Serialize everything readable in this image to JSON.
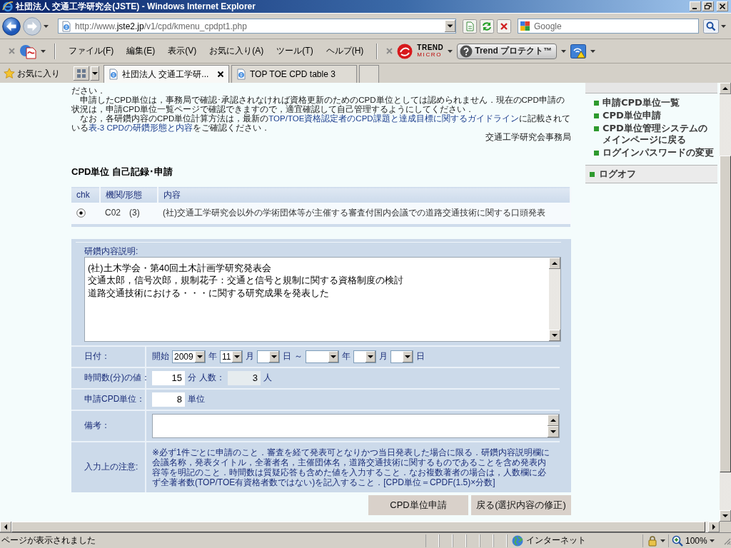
{
  "window": {
    "title": "社団法人 交通工学研究会(JSTE) - Windows Internet Explorer"
  },
  "address_bar": {
    "url": "http://www.jste2.jp/v1/cpd/kmenu_cpdpt1.php"
  },
  "search": {
    "placeholder": "Google"
  },
  "menu_bar": {
    "items": [
      "ファイル(F)",
      "編集(E)",
      "表示(V)",
      "お気に入り(A)",
      "ツール(T)",
      "ヘルプ(H)"
    ]
  },
  "toolbar": {
    "logo_top": "TREND",
    "logo_bottom": "MICRO",
    "protect_button": "Trend プロテクト™"
  },
  "favorites_bar": {
    "label": "お気に入り"
  },
  "tabs": [
    {
      "label": "社団法人 交通工学研...",
      "selected": true
    },
    {
      "label": "TOP TOE CPD table 3",
      "selected": false
    }
  ],
  "intro": {
    "paragraphs": [
      [
        {
          "kind": "text",
          "text": "ださい．"
        }
      ],
      [
        {
          "kind": "text",
          "text": "　申請したCPD単位は，事務局で確認･承認されなければ資格更新のためのCPD単位としては認められません．現在のCPD申請の状況は，申請CPD単位一覧ページで確認できますので，適宜確認して自己管理するようにしてください．"
        }
      ],
      [
        {
          "kind": "text",
          "text": "　なお，各研鑽内容のCPD単位計算方法は，最新の"
        },
        {
          "kind": "link",
          "text": "TOP/TOE資格認定者のCPD課題と達成目標に関するガイドライン"
        },
        {
          "kind": "text",
          "text": "に記載されている"
        },
        {
          "kind": "link",
          "text": "表-3 CPDの研鑽形態と内容"
        },
        {
          "kind": "text",
          "text": "をご確認ください．"
        }
      ]
    ],
    "signature": "交通工学研究会事務局"
  },
  "section_title": "CPD単位 自己記録･申請",
  "table": {
    "columns": [
      "chk",
      "機関/形態",
      "内容"
    ],
    "rows": [
      {
        "selected": true,
        "organization_form": "C02　(3)",
        "content": "(社)交通工学研究会以外の学術団体等が主催する審査付国内会議での道路交通技術に関する口頭発表"
      }
    ]
  },
  "form": {
    "description": {
      "label": "研鑽内容説明:",
      "lines": [
        "(社)土木学会・第40回土木計画学研究発表会",
        "交通太郎，信号次郎，規制花子：交通と信号と規制に関する資格制度の検討",
        "道路交通技術における・・・に関する研究成果を発表した"
      ]
    },
    "rows": [
      {
        "label": "日付：",
        "parts": [
          {
            "kind": "text",
            "text": "開始"
          },
          {
            "kind": "select",
            "value": "2009",
            "wide": true
          },
          {
            "kind": "text",
            "text": "年"
          },
          {
            "kind": "select",
            "value": "11",
            "wide": false
          },
          {
            "kind": "text",
            "text": "月"
          },
          {
            "kind": "select",
            "wide": false
          },
          {
            "kind": "text",
            "text": "日"
          },
          {
            "kind": "text",
            "text": "～"
          },
          {
            "kind": "select",
            "wide": true
          },
          {
            "kind": "text",
            "text": "年"
          },
          {
            "kind": "select",
            "wide": false
          },
          {
            "kind": "text",
            "text": "月"
          },
          {
            "kind": "select",
            "wide": false
          },
          {
            "kind": "text",
            "text": "日"
          }
        ]
      },
      {
        "label": "時間数(分)の値：",
        "parts": [
          {
            "kind": "input",
            "value": "15",
            "disabled": false
          },
          {
            "kind": "text",
            "text": "分"
          },
          {
            "kind": "text",
            "text": "人数："
          },
          {
            "kind": "input",
            "value": "3",
            "disabled": true
          },
          {
            "kind": "text",
            "text": "人"
          }
        ]
      },
      {
        "label": "申請CPD単位：",
        "parts": [
          {
            "kind": "input",
            "value": "8",
            "disabled": false
          },
          {
            "kind": "text",
            "text": "単位"
          }
        ]
      },
      {
        "label": "備考：",
        "parts": [
          {
            "kind": "textarea"
          }
        ]
      },
      {
        "label": "入力上の注意:",
        "parts": [
          {
            "kind": "note",
            "text": "※必ず1件ごとに申請のこと．審査を経て発表可となりかつ当日発表した場合に限る．研鑽内容説明欄に会議名称，発表タイトル，全著者名，主催団体名，道路交通技術に関するものであることを含め発表内容等を明記のこと．時間数は質疑応答も含めた値を入力すること．なお複数著者の場合は，人数欄に必ず全著者数(TOP/TOE有資格者数ではない)を記入すること．[CPD単位＝CPDF(1.5)×分数]"
          }
        ]
      }
    ]
  },
  "buttons": [
    "CPD単位申請",
    "戻る(選択内容の修正)"
  ],
  "sidebar": {
    "items": [
      "申請CPD単位一覧",
      "CPD単位申請",
      "CPD単位管理システムのメインページに戻る",
      "ログインパスワードの変更"
    ],
    "logoff": "ログオフ"
  },
  "status_bar": {
    "text": "ページが表示されました",
    "zone": "インターネット",
    "zoom": "100%"
  }
}
